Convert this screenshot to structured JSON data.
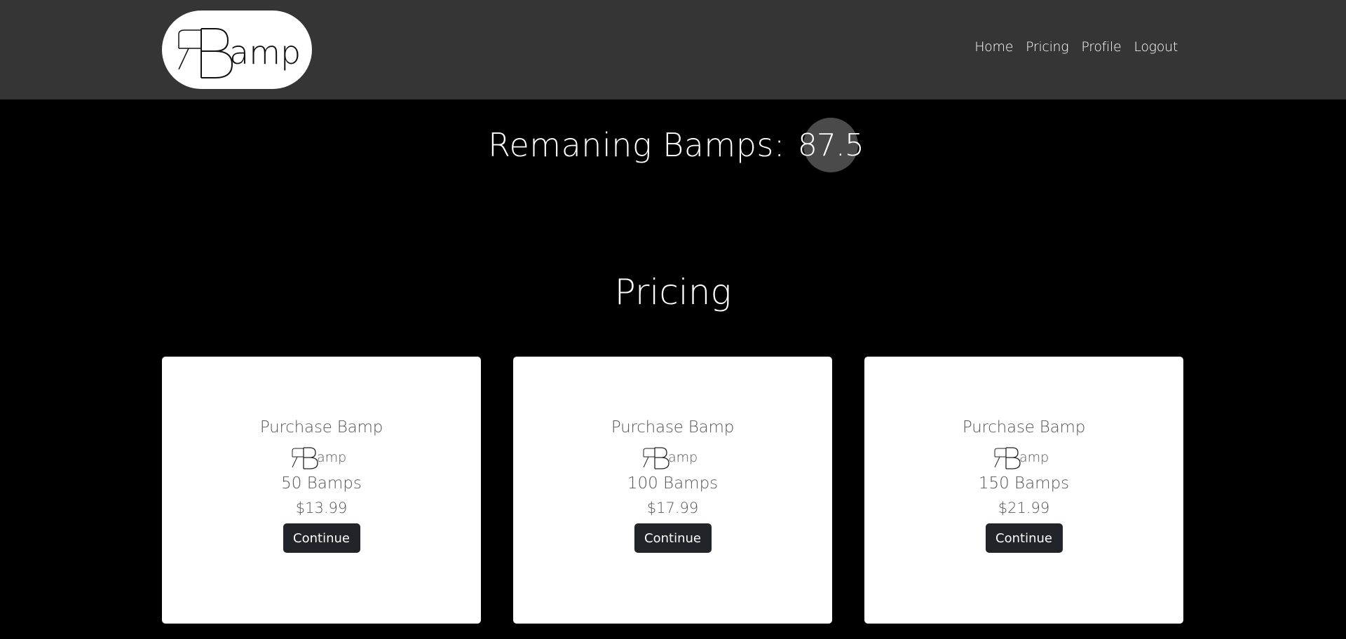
{
  "header": {
    "logo_alt": "RBamp",
    "nav": [
      {
        "label": "Home"
      },
      {
        "label": "Pricing"
      },
      {
        "label": "Profile"
      },
      {
        "label": "Logout"
      }
    ]
  },
  "balance": {
    "label": "Remaning Bamps:",
    "value": "87.5"
  },
  "pricing": {
    "title": "Pricing",
    "cards": [
      {
        "title": "Purchase Bamp",
        "amount": "50 Bamps",
        "price": "$13.99",
        "button": "Continue"
      },
      {
        "title": "Purchase Bamp",
        "amount": "100 Bamps",
        "price": "$17.99",
        "button": "Continue"
      },
      {
        "title": "Purchase Bamp",
        "amount": "150 Bamps",
        "price": "$21.99",
        "button": "Continue"
      }
    ]
  },
  "colors": {
    "page_bg": "#000000",
    "navbar_bg": "#353535",
    "button_bg": "#212529",
    "balance_bubble": "#4a4a4a"
  }
}
